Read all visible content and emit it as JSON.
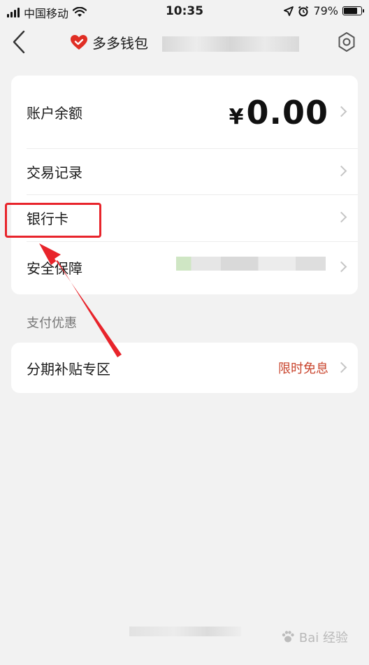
{
  "status_bar": {
    "carrier": "中国移动",
    "time": "10:35",
    "battery": "79%",
    "battery_level": 0.79
  },
  "nav": {
    "title": "多多钱包",
    "brand_color": "#e02e24"
  },
  "account_card": {
    "balance_label": "账户余额",
    "currency_symbol": "¥",
    "balance_amount": "0.00",
    "transactions_label": "交易记录",
    "bank_card_label": "银行卡",
    "security_label": "安全保障"
  },
  "section": {
    "title": "支付优惠"
  },
  "promo_card": {
    "label": "分期补贴专区",
    "value": "限时免息",
    "value_color": "#c9452e"
  },
  "annotation": {
    "color": "#e8242b"
  },
  "watermark": {
    "text": "Bai 经验"
  }
}
